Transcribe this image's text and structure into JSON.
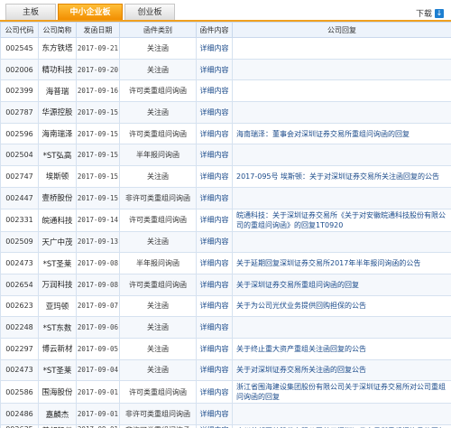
{
  "tabs": [
    "主板",
    "中小企业板",
    "创业板"
  ],
  "active_tab": 1,
  "download": {
    "label": "下载",
    "icon": "download-icon"
  },
  "columns": [
    "公司代码",
    "公司简称",
    "发函日期",
    "函件类别",
    "函件内容",
    "公司回复"
  ],
  "rows": [
    {
      "code": "002545",
      "name": "东方铁塔",
      "date": "2017-09-21",
      "type": "关注函",
      "content": "详细内容",
      "reply": ""
    },
    {
      "code": "002006",
      "name": "精功科技",
      "date": "2017-09-20",
      "type": "关注函",
      "content": "详细内容",
      "reply": ""
    },
    {
      "code": "002399",
      "name": "海普瑞",
      "date": "2017-09-16",
      "type": "许可类重组问询函",
      "content": "详细内容",
      "reply": ""
    },
    {
      "code": "002787",
      "name": "华源控股",
      "date": "2017-09-15",
      "type": "关注函",
      "content": "详细内容",
      "reply": ""
    },
    {
      "code": "002596",
      "name": "海南瑞泽",
      "date": "2017-09-15",
      "type": "许可类重组问询函",
      "content": "详细内容",
      "reply": "海南瑞泽：董事会对深圳证券交易所重组问询函的回复"
    },
    {
      "code": "002504",
      "name": "*ST弘高",
      "date": "2017-09-15",
      "type": "半年报问询函",
      "content": "详细内容",
      "reply": ""
    },
    {
      "code": "002747",
      "name": "埃斯顿",
      "date": "2017-09-15",
      "type": "关注函",
      "content": "详细内容",
      "reply": "2017-095号 埃斯顿：关于对深圳证券交易所关注函回复的公告"
    },
    {
      "code": "002447",
      "name": "壹桥股份",
      "date": "2017-09-15",
      "type": "非许可类重组问询函",
      "content": "详细内容",
      "reply": ""
    },
    {
      "code": "002331",
      "name": "皖通科技",
      "date": "2017-09-14",
      "type": "许可类重组问询函",
      "content": "详细内容",
      "reply": "皖通科技：关于深圳证券交易所《关于对安徽皖通科技股份有限公司的重组问询函》的回复1T0920"
    },
    {
      "code": "002509",
      "name": "天广中茂",
      "date": "2017-09-13",
      "type": "关注函",
      "content": "详细内容",
      "reply": ""
    },
    {
      "code": "002473",
      "name": "*ST圣莱",
      "date": "2017-09-08",
      "type": "半年报问询函",
      "content": "详细内容",
      "reply": "关于延期回复深圳证券交易所2017年半年报问询函的公告"
    },
    {
      "code": "002654",
      "name": "万润科技",
      "date": "2017-09-08",
      "type": "许可类重组问询函",
      "content": "详细内容",
      "reply": "关于深圳证券交易所重组问询函的回复"
    },
    {
      "code": "002623",
      "name": "亚玛顿",
      "date": "2017-09-07",
      "type": "关注函",
      "content": "详细内容",
      "reply": "关于为公司光伏业务提供回购担保的公告"
    },
    {
      "code": "002248",
      "name": "*ST东数",
      "date": "2017-09-06",
      "type": "关注函",
      "content": "详细内容",
      "reply": ""
    },
    {
      "code": "002297",
      "name": "博云新材",
      "date": "2017-09-05",
      "type": "关注函",
      "content": "详细内容",
      "reply": "关于终止重大资产重组关注函回复的公告"
    },
    {
      "code": "002473",
      "name": "*ST圣莱",
      "date": "2017-09-04",
      "type": "关注函",
      "content": "详细内容",
      "reply": "关于对深圳证券交易所关注函的回复公告"
    },
    {
      "code": "002586",
      "name": "围海股份",
      "date": "2017-09-01",
      "type": "许可类重组问询函",
      "content": "详细内容",
      "reply": "浙江省围海建设集团股份有限公司关于深圳证券交易所对公司重组问询函的回复"
    },
    {
      "code": "002486",
      "name": "嘉麟杰",
      "date": "2017-09-01",
      "type": "非许可类重组问询函",
      "content": "详细内容",
      "reply": ""
    },
    {
      "code": "002635",
      "name": "普邦股份",
      "date": "2017-09-01",
      "type": "非许可类重组问询函",
      "content": "详细内容",
      "reply": "广州普邦园林股份有限公司关于深圳证券交易所重组问询函的回复"
    }
  ]
}
